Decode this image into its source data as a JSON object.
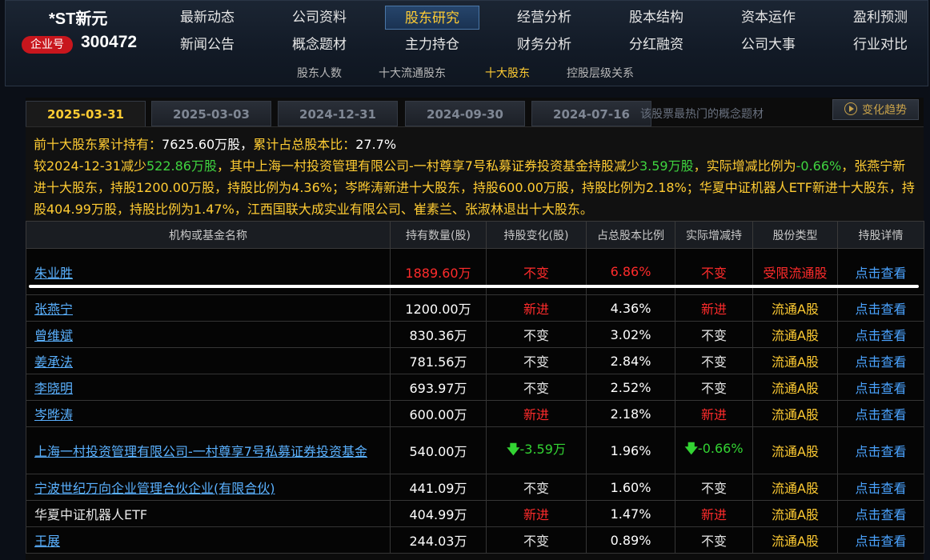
{
  "header": {
    "stock_name": "*ST新元",
    "badge": "企业号",
    "stock_code": "300472",
    "nav_row1": [
      "最新动态",
      "公司资料",
      "股东研究",
      "经营分析",
      "股本结构",
      "资本运作",
      "盈利预测"
    ],
    "nav_row2": [
      "新闻公告",
      "概念题材",
      "主力持仓",
      "财务分析",
      "分红融资",
      "公司大事",
      "行业对比"
    ],
    "active_nav": "股东研究",
    "sub_nav": [
      "股东人数",
      "十大流通股东",
      "十大股东",
      "控股层级关系"
    ],
    "active_sub_nav": "十大股东"
  },
  "tabs": [
    "2025-03-31",
    "2025-03-03",
    "2024-12-31",
    "2024-09-30",
    "2024-07-16"
  ],
  "active_tab": "2025-03-31",
  "hot_concept_hint": "该股票最热门的概念题材",
  "trend_button": "变化趋势",
  "summary": {
    "l1_a": "前十大股东累计持有：",
    "l1_b": "7625.60万股，",
    "l1_c": "累计占总股本比：",
    "l1_d": "27.7%",
    "l2_a": "较2024-12-31减少",
    "l2_b": "522.86万股",
    "l2_c": "，其中上海一村投资管理有限公司-一村尊享7号私募证券投资基金持股减少",
    "l2_d": "3.59万股",
    "l2_e": "，实际增减比例为",
    "l2_f": "-0.66%",
    "rest": "，张燕宁新进十大股东，持股1200.00万股，持股比例为4.36%；岑晔涛新进十大股东，持股600.00万股，持股比例为2.18%；华夏中证机器人ETF新进十大股东，持股404.99万股，持股比例为1.47%，江西国联大成实业有限公司、崔素兰、张淑林退出十大股东。"
  },
  "table": {
    "headers": [
      "机构或基金名称",
      "持有数量(股)",
      "持股变化(股)",
      "占总股本比例",
      "实际增减持",
      "股份类型",
      "持股详情"
    ],
    "rows": [
      {
        "name": "朱业胜",
        "qty": "1889.60万",
        "change": "不变",
        "ratio": "6.86%",
        "actual": "不变",
        "type": "受限流通股",
        "detail": "点击查看"
      },
      {
        "name": "张燕宁",
        "qty": "1200.00万",
        "change": "新进",
        "ratio": "4.36%",
        "actual": "新进",
        "type": "流通A股",
        "detail": "点击查看"
      },
      {
        "name": "曾维斌",
        "qty": "830.36万",
        "change": "不变",
        "ratio": "3.02%",
        "actual": "不变",
        "type": "流通A股",
        "detail": "点击查看"
      },
      {
        "name": "姜承法",
        "qty": "781.56万",
        "change": "不变",
        "ratio": "2.84%",
        "actual": "不变",
        "type": "流通A股",
        "detail": "点击查看"
      },
      {
        "name": "李晓明",
        "qty": "693.97万",
        "change": "不变",
        "ratio": "2.52%",
        "actual": "不变",
        "type": "流通A股",
        "detail": "点击查看"
      },
      {
        "name": "岑晔涛",
        "qty": "600.00万",
        "change": "新进",
        "ratio": "2.18%",
        "actual": "新进",
        "type": "流通A股",
        "detail": "点击查看"
      },
      {
        "name": "上海一村投资管理有限公司-一村尊享7号私募证券投资基金",
        "qty": "540.00万",
        "change": "-3.59万",
        "ratio": "1.96%",
        "actual": "-0.66%",
        "type": "流通A股",
        "detail": "点击查看"
      },
      {
        "name": "宁波世纪万向企业管理合伙企业(有限合伙)",
        "qty": "441.09万",
        "change": "不变",
        "ratio": "1.60%",
        "actual": "不变",
        "type": "流通A股",
        "detail": "点击查看"
      },
      {
        "name": "华夏中证机器人ETF",
        "qty": "404.99万",
        "change": "新进",
        "ratio": "1.47%",
        "actual": "新进",
        "type": "流通A股",
        "detail": "点击查看"
      },
      {
        "name": "王展",
        "qty": "244.03万",
        "change": "不变",
        "ratio": "0.89%",
        "actual": "不变",
        "type": "流通A股",
        "detail": "点击查看"
      }
    ]
  },
  "colors": {
    "accent": "#ffcc33",
    "up": "#ff2b2b",
    "down": "#33d433",
    "link": "#5ab1ff"
  }
}
